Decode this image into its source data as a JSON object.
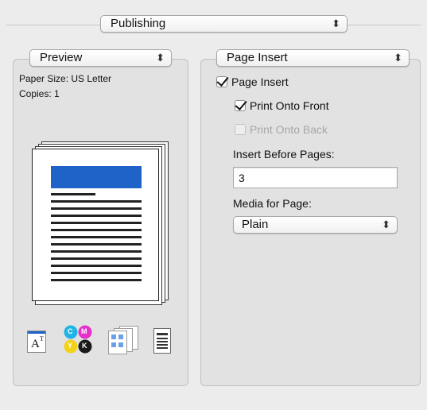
{
  "top_popup": {
    "label": "Publishing",
    "arrows": "⬍"
  },
  "left_panel": {
    "popup_label": "Preview",
    "arrows": "⬍",
    "paper_size": "Paper Size: US Letter",
    "copies": "Copies: 1",
    "accent_color": "#1f63c8"
  },
  "right_panel": {
    "popup_label": "Page Insert",
    "arrows": "⬍",
    "page_insert_label": "Page Insert",
    "page_insert_checked": true,
    "print_onto_front_label": "Print Onto Front",
    "print_onto_front_checked": true,
    "print_onto_back_label": "Print Onto Back",
    "print_onto_back_checked": false,
    "insert_before_pages_label": "Insert Before Pages:",
    "insert_before_pages_value": "3",
    "media_for_page_label": "Media for Page:",
    "media_for_page_value": "Plain"
  },
  "icons": {
    "font_icon_text": "A",
    "font_icon_super": "T",
    "cmyk_labels": [
      "C",
      "M",
      "Y",
      "K"
    ]
  }
}
